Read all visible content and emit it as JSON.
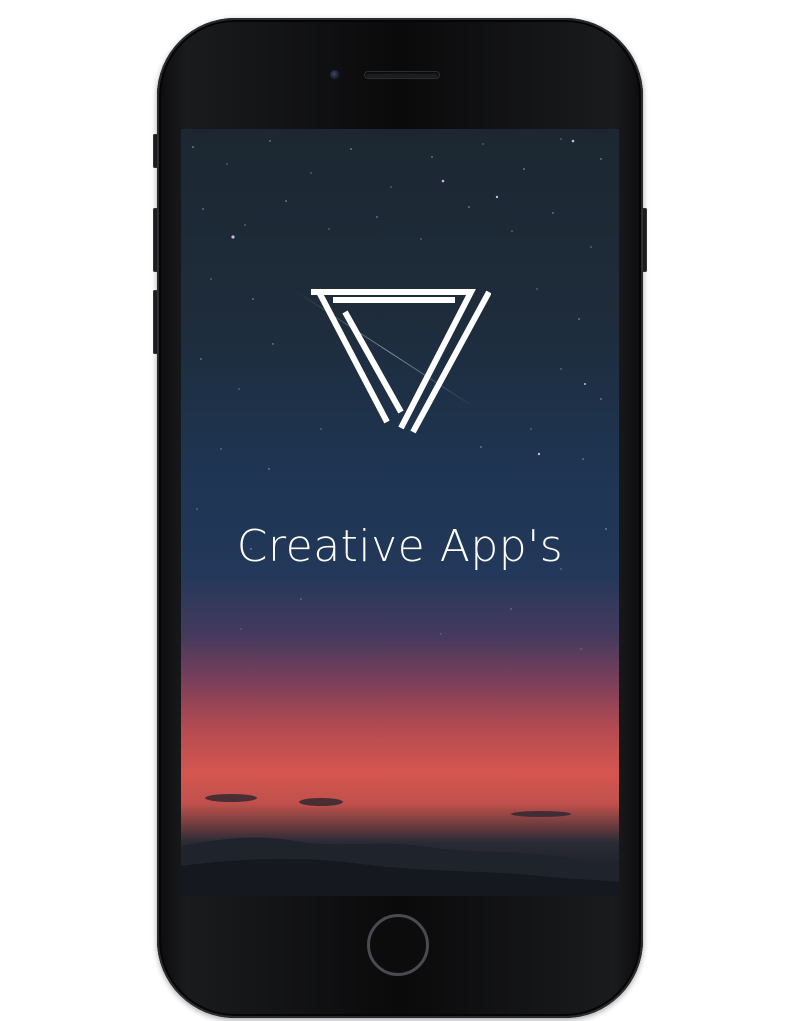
{
  "splash": {
    "title": "Creative App's"
  },
  "icons": {
    "logo": "triangle-logo-icon"
  },
  "colors": {
    "sky_top": "#1c2731",
    "sky_mid": "#1e3553",
    "sunset": "#d5564e",
    "text": "#ffffff"
  }
}
